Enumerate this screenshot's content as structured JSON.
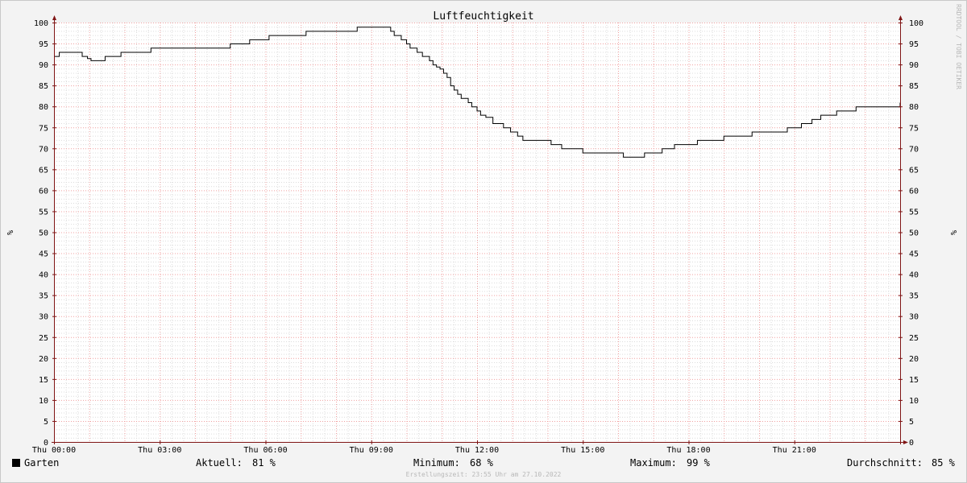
{
  "chart_data": {
    "type": "line",
    "title": "Luftfeuchtigkeit",
    "ylabel": "%",
    "ylim": [
      0,
      100
    ],
    "y_ticks": [
      0,
      5,
      10,
      15,
      20,
      25,
      30,
      35,
      40,
      45,
      50,
      55,
      60,
      65,
      70,
      75,
      80,
      85,
      90,
      95,
      100
    ],
    "x_ticks": [
      "Thu 00:00",
      "Thu 03:00",
      "Thu 06:00",
      "Thu 09:00",
      "Thu 12:00",
      "Thu 15:00",
      "Thu 18:00",
      "Thu 21:00"
    ],
    "x_tick_hours": [
      0,
      3,
      6,
      9,
      12,
      15,
      18,
      21
    ],
    "xlim_hours": [
      0,
      24
    ],
    "grid": true,
    "watermark": "RRDTOOL / TOBI OETIKER",
    "series": [
      {
        "name": "Garten",
        "color": "#000000",
        "step": true,
        "x_hours": [
          0.0,
          0.15,
          0.8,
          0.95,
          1.05,
          1.45,
          1.9,
          2.75,
          5.0,
          5.55,
          6.1,
          7.15,
          8.6,
          9.55,
          9.65,
          9.85,
          10.0,
          10.1,
          10.3,
          10.45,
          10.65,
          10.75,
          10.85,
          10.95,
          11.05,
          11.15,
          11.25,
          11.35,
          11.45,
          11.55,
          11.75,
          11.85,
          12.0,
          12.1,
          12.25,
          12.45,
          12.75,
          12.95,
          13.15,
          13.3,
          14.1,
          14.4,
          15.0,
          16.15,
          16.75,
          17.25,
          17.6,
          18.25,
          19.0,
          19.8,
          20.8,
          21.2,
          21.5,
          21.75,
          22.2,
          22.75,
          24.0
        ],
        "values": [
          92,
          93,
          92,
          91.5,
          91,
          92,
          93,
          94,
          95,
          96,
          97,
          98,
          99,
          98,
          97,
          96,
          95,
          94,
          93,
          92,
          91,
          90,
          89.5,
          89,
          88,
          87,
          85,
          84,
          83,
          82,
          81,
          80,
          79,
          78,
          77.5,
          76,
          75,
          74,
          73,
          72,
          71,
          70,
          69,
          68,
          69,
          70,
          71,
          72,
          73,
          74,
          75,
          76,
          77,
          78,
          79,
          80,
          81
        ]
      }
    ],
    "legend": {
      "series_name": "Garten",
      "current_label": "Aktuell:",
      "current_value": "81 %",
      "min_label": "Minimum:",
      "min_value": "68 %",
      "max_label": "Maximum:",
      "max_value": "99 %",
      "avg_label": "Durchschnitt:",
      "avg_value": "85 %"
    },
    "footer": "Erstellungszeit: 23:55 Uhr am 27.10.2022",
    "colors": {
      "background": "#f3f3f3",
      "canvas": "#ffffff",
      "grid_minor": "#dcdcdc",
      "grid_major": "#f0a0a0",
      "axis": "#7f1414",
      "line": "#000000"
    }
  }
}
